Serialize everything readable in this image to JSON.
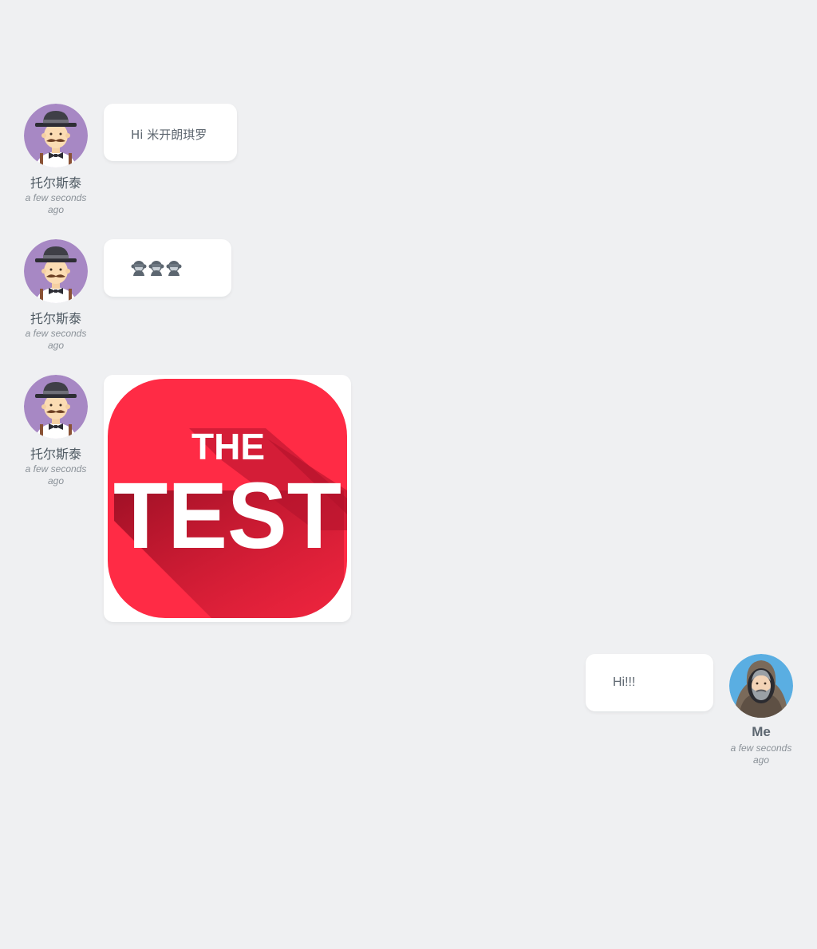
{
  "messages": [
    {
      "author": "托尔斯泰",
      "time": "a few seconds ago",
      "text": "Hi 米开朗琪罗",
      "type": "text",
      "side": "left"
    },
    {
      "author": "托尔斯泰",
      "time": "a few seconds ago",
      "emojis": [
        "see-no-evil-monkey",
        "see-no-evil-monkey",
        "see-no-evil-monkey"
      ],
      "type": "emoji",
      "side": "left"
    },
    {
      "author": "托尔斯泰",
      "time": "a few seconds ago",
      "image_text": {
        "line1": "THE",
        "line2": "TEST"
      },
      "type": "image",
      "side": "left"
    },
    {
      "author": "Me",
      "time": "a few seconds ago",
      "text": "Hi!!!",
      "type": "text",
      "side": "right"
    }
  ],
  "colors": {
    "background": "#eff0f2",
    "bubble": "#ffffff",
    "text": "#5f6871",
    "avatar_other_bg": "#a788c4",
    "avatar_me_bg": "#5aaee2",
    "test_image_red": "#ff2b45"
  },
  "icons": {
    "avatar_other": "man-with-bowler-hat-avatar",
    "avatar_me": "hooded-bearded-man-avatar"
  }
}
